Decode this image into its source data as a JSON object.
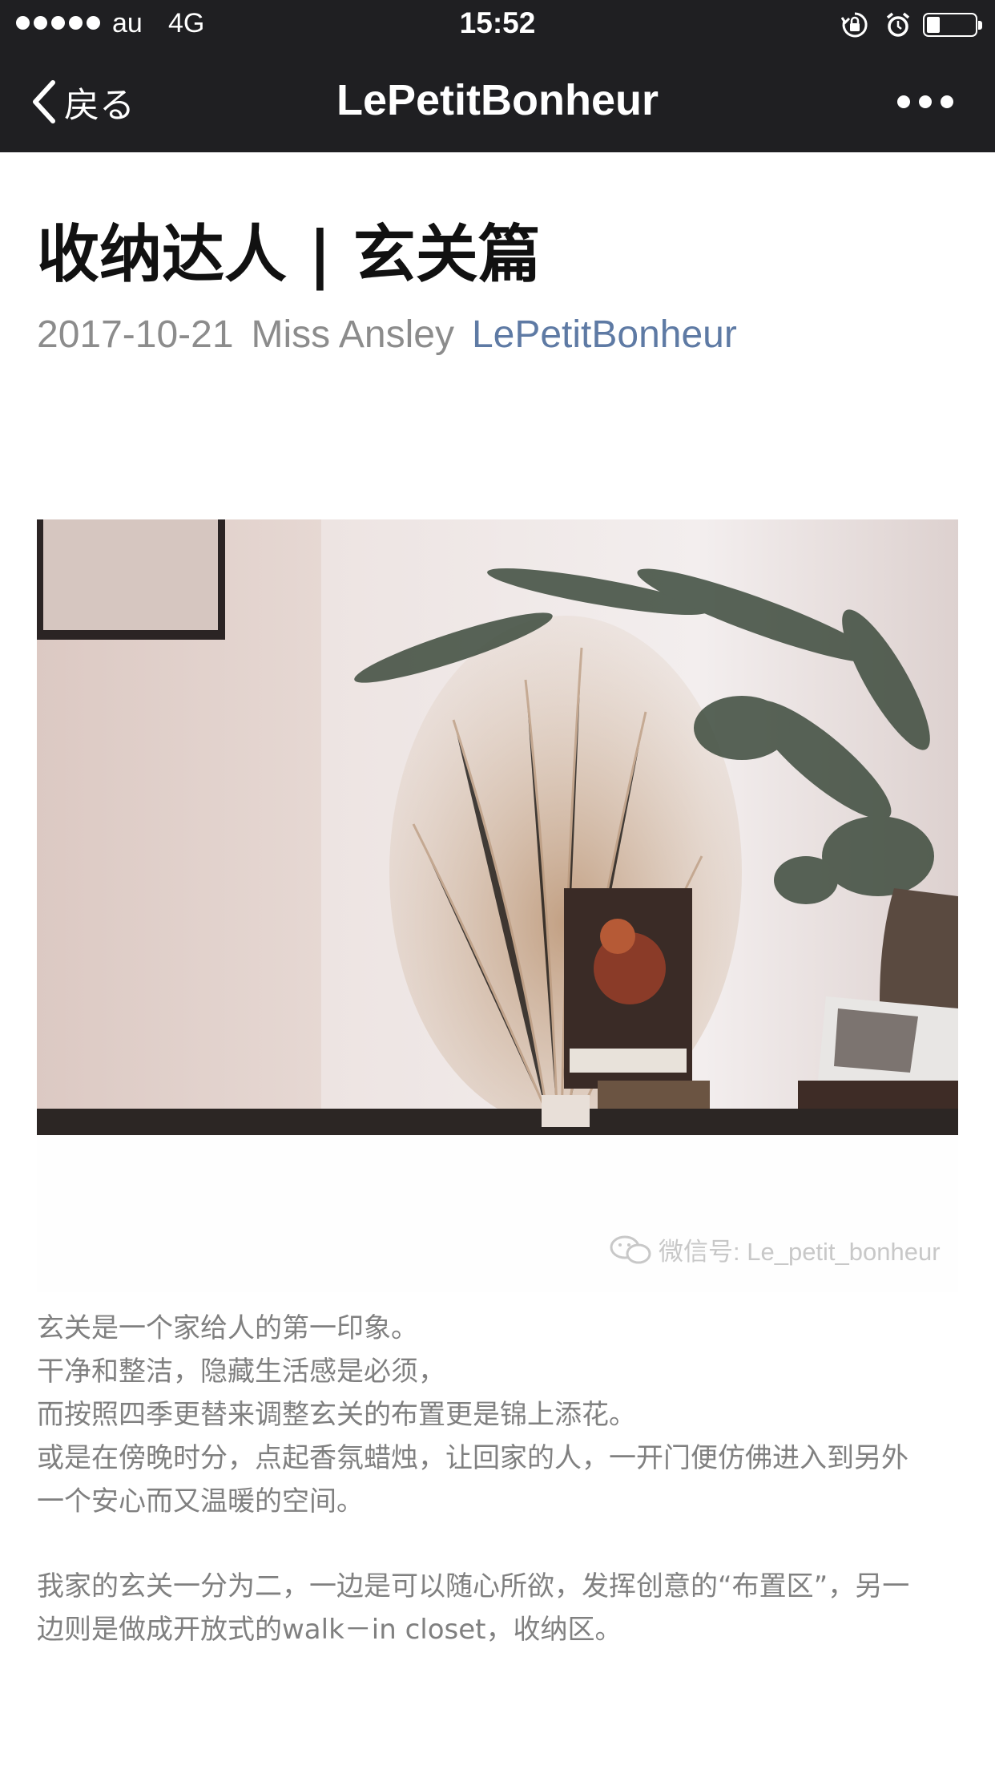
{
  "status_bar": {
    "carrier": "au",
    "network": "4G",
    "time": "15:52"
  },
  "nav": {
    "back_label": "戻る",
    "title": "LePetitBonheur",
    "icons": [
      "chevron-left-icon",
      "more-dots-icon"
    ]
  },
  "article": {
    "title": "收纳达人 | 玄关篇",
    "date": "2017-10-21",
    "author": "Miss Ansley",
    "account": "LePetitBonheur",
    "watermark": "微信号: Le_petit_bonheur",
    "paragraph1": [
      "玄关是一个家给人的第一印象。",
      "干净和整洁，隐藏生活感是必须，",
      "而按照四季更替来调整玄关的布置更是锦上添花。",
      "或是在傍晚时分，点起香氛蜡烛，让回家的人，一开门便仿佛进入到另外",
      "一个安心而又温暖的空间。"
    ],
    "paragraph2": [
      "我家的玄关一分为二，一边是可以随心所欲，发挥创意的“布置区”，另一",
      "边则是做成开放式的walk－in closet，收纳区。"
    ]
  },
  "colors": {
    "nav_background": "#1f1f22",
    "account_link": "#5e7aa4",
    "meta_gray": "#8c8c8c",
    "body_gray": "#808080"
  }
}
